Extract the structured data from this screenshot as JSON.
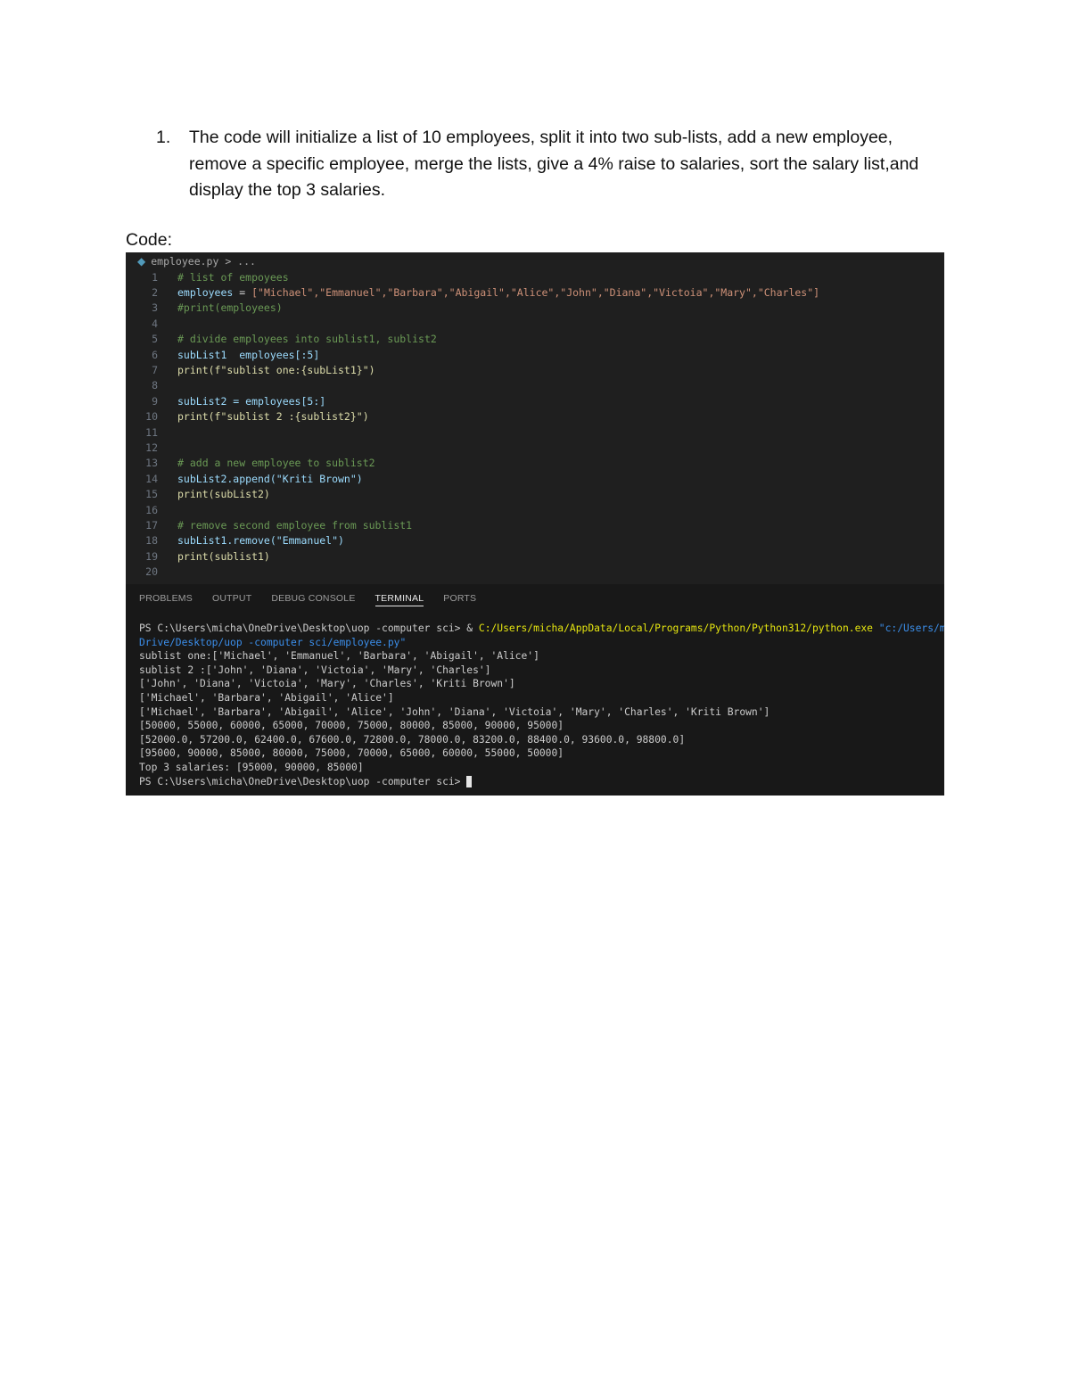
{
  "task": {
    "number": "1.",
    "text": "The code will initialize a list of 10 employees, split it into two sub-lists, add a new employee, remove a specific employee, merge the lists, give a 4% raise to salaries, sort the salary list,and display the top 3 salaries."
  },
  "code_label": "Code:",
  "editor": {
    "breadcrumb": "employee.py > ...",
    "line_numbers": [
      "1",
      "2",
      "3",
      "4",
      "5",
      "6",
      "7",
      "8",
      "9",
      "10",
      "11",
      "12",
      "13",
      "14",
      "15",
      "16",
      "17",
      "18",
      "19",
      "20"
    ],
    "lines": {
      "l1_comment": "# list of empoyees",
      "l2_var": "employees",
      "l2_op": " = ",
      "l2_values": "[\"Michael\",\"Emmanuel\",\"Barbara\",\"Abigail\",\"Alice\",\"John\",\"Diana\",\"Victoia\",\"Mary\",\"Charles\"]",
      "l3_comment": "#print(employees)",
      "l5_comment": "# divide employees into sublist1, sublist2",
      "l6_code": "subList1  employees[:5]",
      "l7_code": "print(f\"sublist one:{subList1}\")",
      "l9_code": "subList2 = employees[5:]",
      "l10_code": "print(f\"sublist 2 :{sublist2}\")",
      "l13_comment": "# add a new employee to sublist2",
      "l14_code": "subList2.append(\"Kriti Brown\")",
      "l15_code": "print(subList2)",
      "l17_comment": "# remove second employee from sublist1",
      "l18_code": "subList1.remove(\"Emmanuel\")",
      "l19_code": "print(sublist1)"
    }
  },
  "panel": {
    "tabs": [
      "PROBLEMS",
      "OUTPUT",
      "DEBUG CONSOLE",
      "TERMINAL",
      "PORTS"
    ],
    "active_tab": "TERMINAL",
    "terminal": {
      "prompt1": "PS C:\\Users\\micha\\OneDrive\\Desktop\\uop -computer sci> ",
      "cmd_amp": "& ",
      "cmd_exe": "C:/Users/micha/AppData/Local/Programs/Python/Python312/python.exe",
      "cmd_arg": " \"c:/Users/micha/One",
      "cmd_arg_cont": "Drive/Desktop/uop -computer sci/employee.py\"",
      "output": [
        "sublist one:['Michael', 'Emmanuel', 'Barbara', 'Abigail', 'Alice']",
        "sublist 2 :['John', 'Diana', 'Victoia', 'Mary', 'Charles']",
        "['John', 'Diana', 'Victoia', 'Mary', 'Charles', 'Kriti Brown']",
        "['Michael', 'Barbara', 'Abigail', 'Alice']",
        "['Michael', 'Barbara', 'Abigail', 'Alice', 'John', 'Diana', 'Victoia', 'Mary', 'Charles', 'Kriti Brown']",
        "[50000, 55000, 60000, 65000, 70000, 75000, 80000, 85000, 90000, 95000]",
        "[52000.0, 57200.0, 62400.0, 67600.0, 72800.0, 78000.0, 83200.0, 88400.0, 93600.0, 98800.0]",
        "[95000, 90000, 85000, 80000, 75000, 70000, 65000, 60000, 55000, 50000]",
        "Top 3 salaries: [95000, 90000, 85000]"
      ],
      "prompt2": "PS C:\\Users\\micha\\OneDrive\\Desktop\\uop -computer sci> "
    }
  }
}
